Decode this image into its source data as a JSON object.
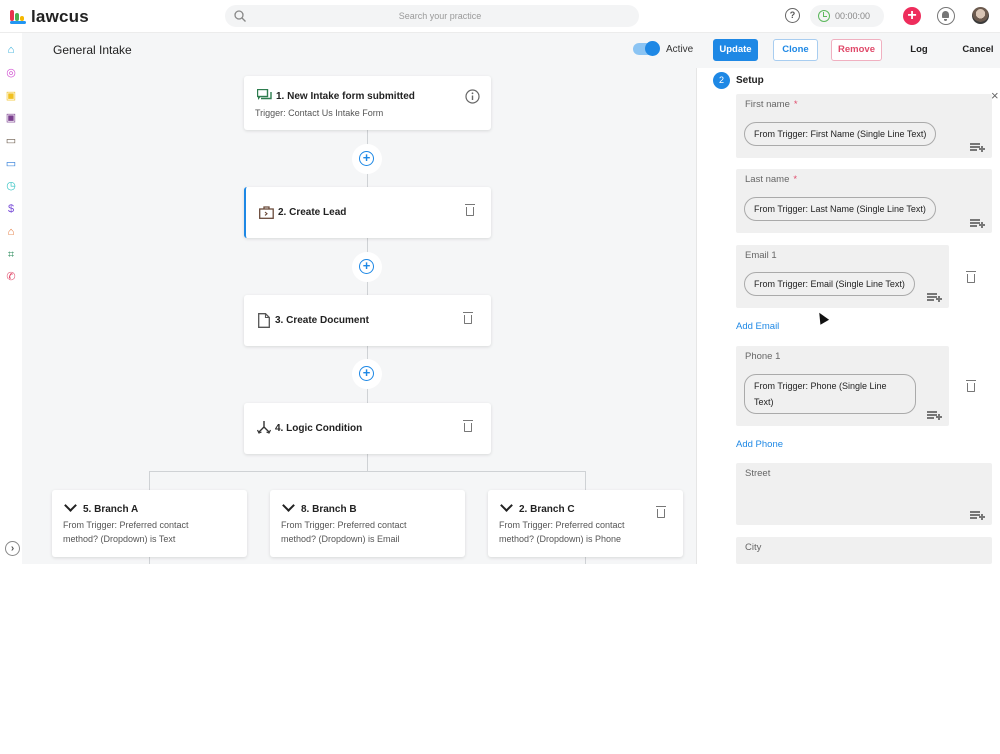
{
  "app": {
    "logo_text": "lawcus",
    "search_placeholder": "Search your practice",
    "timer": "00:00:00",
    "help_glyph": "?",
    "plus_glyph": "+"
  },
  "sidebar": {
    "icons": [
      {
        "name": "home-icon",
        "glyph": "⌂",
        "color": "#29a9d8"
      },
      {
        "name": "tasks-icon",
        "glyph": "◎",
        "color": "#d14fd1"
      },
      {
        "name": "calendar-icon",
        "glyph": "▣",
        "color": "#f0c020"
      },
      {
        "name": "contacts-icon",
        "glyph": "▣",
        "color": "#7a3e8e"
      },
      {
        "name": "leads-icon",
        "glyph": "▭",
        "color": "#6a5a4a"
      },
      {
        "name": "matters-icon",
        "glyph": "▭",
        "color": "#2a7ad8"
      },
      {
        "name": "timer-icon",
        "glyph": "◷",
        "color": "#2ac0c0"
      },
      {
        "name": "billing-icon",
        "glyph": "$",
        "color": "#7a4ed8"
      },
      {
        "name": "bank-icon",
        "glyph": "⌂",
        "color": "#e07030"
      },
      {
        "name": "workflow-icon",
        "glyph": "⌗",
        "color": "#2a8a5a"
      },
      {
        "name": "phone-icon",
        "glyph": "✆",
        "color": "#e04a6a"
      }
    ],
    "expand_glyph": "›"
  },
  "header": {
    "title": "General Intake",
    "active_label": "Active",
    "active": true,
    "update_label": "Update",
    "clone_label": "Clone",
    "remove_label": "Remove",
    "log_label": "Log",
    "cancel_label": "Cancel"
  },
  "flow": {
    "steps": [
      {
        "title": "1. New Intake form submitted",
        "subtitle": "Trigger: Contact Us Intake Form"
      },
      {
        "title": "2. Create Lead"
      },
      {
        "title": "3. Create Document"
      },
      {
        "title": "4. Logic Condition"
      }
    ],
    "branches": [
      {
        "title": "5. Branch A",
        "line1": "From Trigger: Preferred contact",
        "line2": "method? (Dropdown) is Text"
      },
      {
        "title": "8. Branch B",
        "line1": "From Trigger: Preferred contact",
        "line2": "method? (Dropdown) is Email"
      },
      {
        "title": "2. Branch C",
        "line1": "From Trigger: Preferred contact",
        "line2": "method? (Dropdown) is Phone"
      }
    ]
  },
  "panel": {
    "step_number": "2",
    "section_label": "Setup",
    "close_glyph": "×",
    "fields": {
      "first_name": {
        "label": "First name",
        "required": "*",
        "value": "From Trigger: First Name (Single Line Text)"
      },
      "last_name": {
        "label": "Last name",
        "required": "*",
        "value": "From Trigger: Last Name (Single Line Text)"
      },
      "email": {
        "label": "Email 1",
        "value": "From Trigger: Email (Single Line Text)"
      },
      "phone": {
        "label": "Phone 1",
        "value": "From Trigger: Phone (Single Line Text)"
      },
      "street": {
        "label": "Street"
      },
      "city": {
        "label": "City"
      }
    },
    "add_email_label": "Add Email",
    "add_phone_label": "Add Phone"
  }
}
